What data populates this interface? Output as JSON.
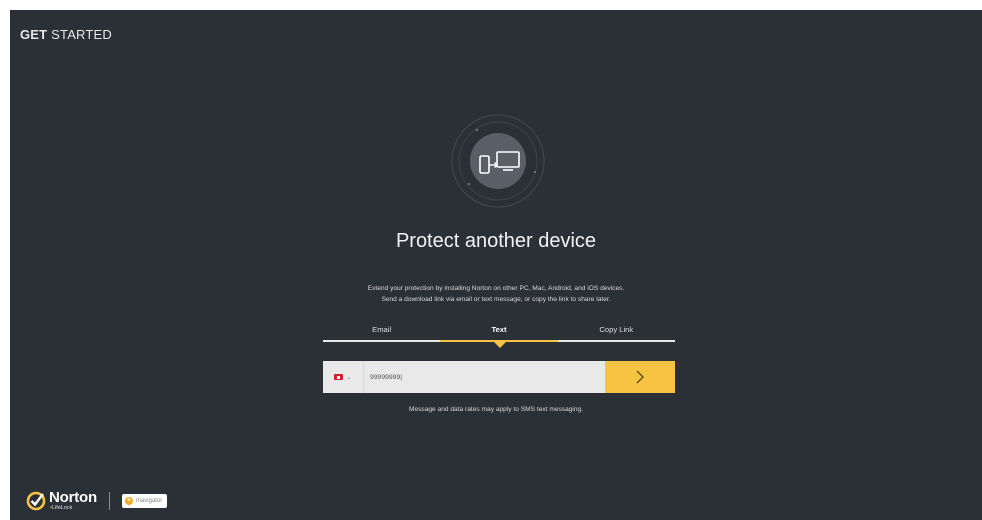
{
  "header": {
    "title_bold": "GET",
    "title_rest": "STARTED"
  },
  "hero": {
    "icon": "devices-icon"
  },
  "main": {
    "title": "Protect another device",
    "description_line1": "Extend your protection by installing Norton on other PC, Mac, Android, and iOS devices.",
    "description_line2": "Send a download link via email or text message, or copy the link to share later."
  },
  "tabs": [
    {
      "label": "Email",
      "active": false
    },
    {
      "label": "Text",
      "active": true
    },
    {
      "label": "Copy Link",
      "active": false
    }
  ],
  "phone": {
    "country_flag": "flag-icon",
    "value": "99999999|",
    "submit_icon": "chevron-right-icon"
  },
  "note": "Message and data rates may apply to SMS text messaging.",
  "footer": {
    "norton": "Norton",
    "lifelock_dot": "•",
    "lifelock": "LifeLock",
    "partner_brand": "mavigator"
  },
  "colors": {
    "background": "#2b2f36",
    "accent": "#f6c343",
    "input": "#e9e9e9"
  }
}
